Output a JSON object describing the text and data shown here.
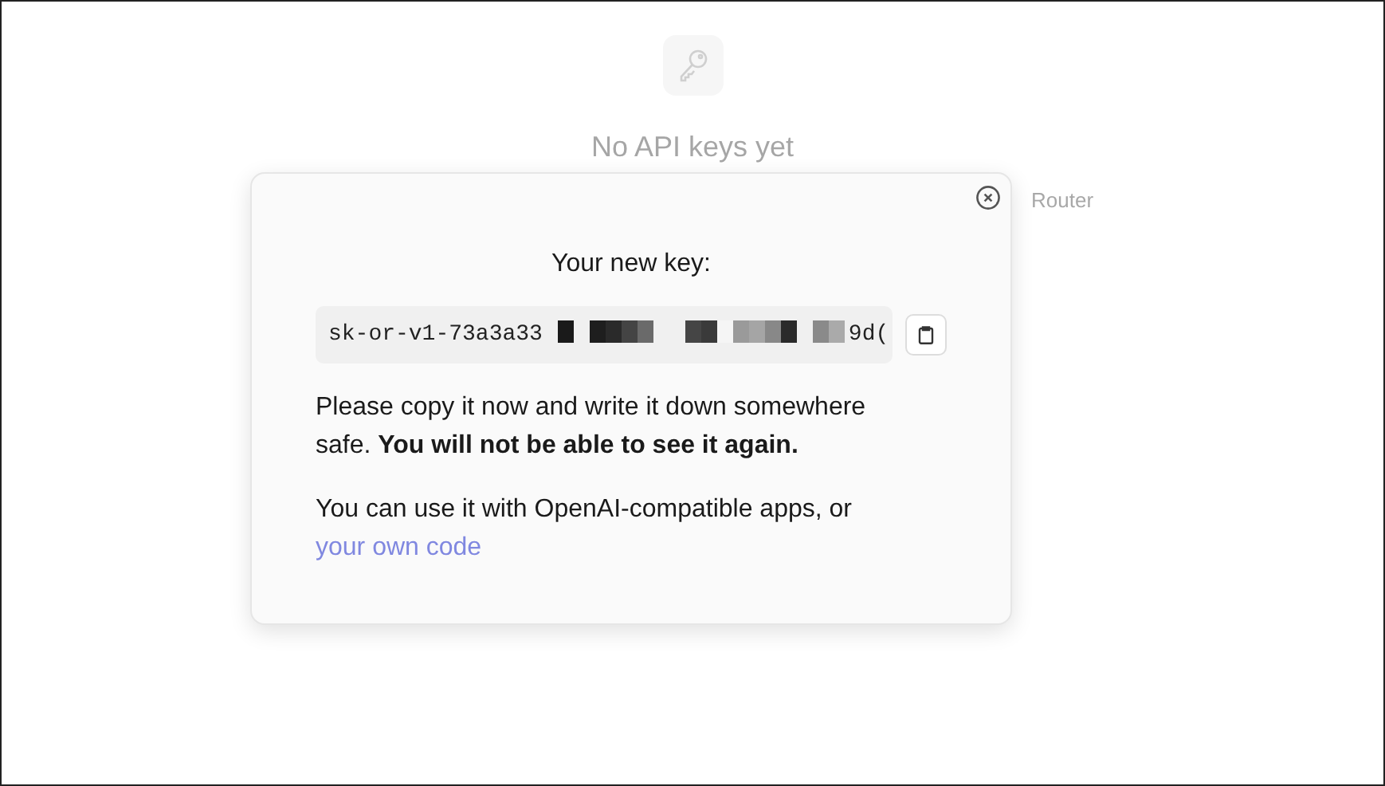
{
  "empty_state": {
    "title": "No API keys yet",
    "subtitle_visible": "Router"
  },
  "dialog": {
    "heading": "Your new key:",
    "key": {
      "start": "sk-or-v1-73a3a33",
      "end": "9d(",
      "redacted": true
    },
    "warning": "Please copy it now and write it down somewhere safe. **You will not be able to see it again.**",
    "usage": "You can use it with OpenAI-compatible apps, or",
    "link": "your own code"
  }
}
